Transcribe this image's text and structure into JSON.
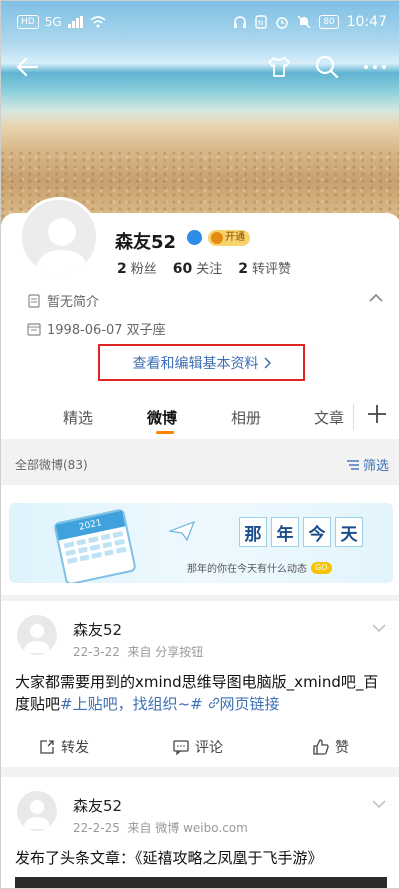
{
  "status_bar": {
    "sim_badge": "HD",
    "net_badge": "5G",
    "battery": "80",
    "time": "10:47"
  },
  "profile": {
    "name": "森友52",
    "vip": "开通",
    "stats": [
      {
        "value": "2",
        "label": "粉丝"
      },
      {
        "value": "60",
        "label": "关注"
      },
      {
        "value": "2",
        "label": "转评赞"
      }
    ],
    "bio": "暂无简介",
    "birthday": "1998-06-07 双子座",
    "edit_link": "查看和编辑基本资料"
  },
  "tabs": [
    "精选",
    "微博",
    "相册",
    "文章"
  ],
  "active_tab": "微博",
  "filter": {
    "left": "全部微博(83)",
    "right": "筛选"
  },
  "banner": {
    "calendar_year": "2021",
    "title": [
      "那",
      "年",
      "今",
      "天"
    ],
    "subtitle": "那年的你在今天有什么动态",
    "go": "GO"
  },
  "posts": [
    {
      "name": "森友52",
      "date": "22-3-22",
      "source": "来自 分享按钮",
      "text": "大家都需要用到的xmind思维导图电脑版_xmind吧_百度贴吧",
      "tag1": "#上贴吧，找组织~#",
      "link": "网页链接",
      "actions": {
        "repost": "转发",
        "comment": "评论",
        "like": "赞"
      }
    },
    {
      "name": "森友52",
      "date": "22-2-25",
      "source": "来自 微博 weibo.com",
      "text": "发布了头条文章：《延禧攻略之凤凰于飞手游》"
    }
  ]
}
